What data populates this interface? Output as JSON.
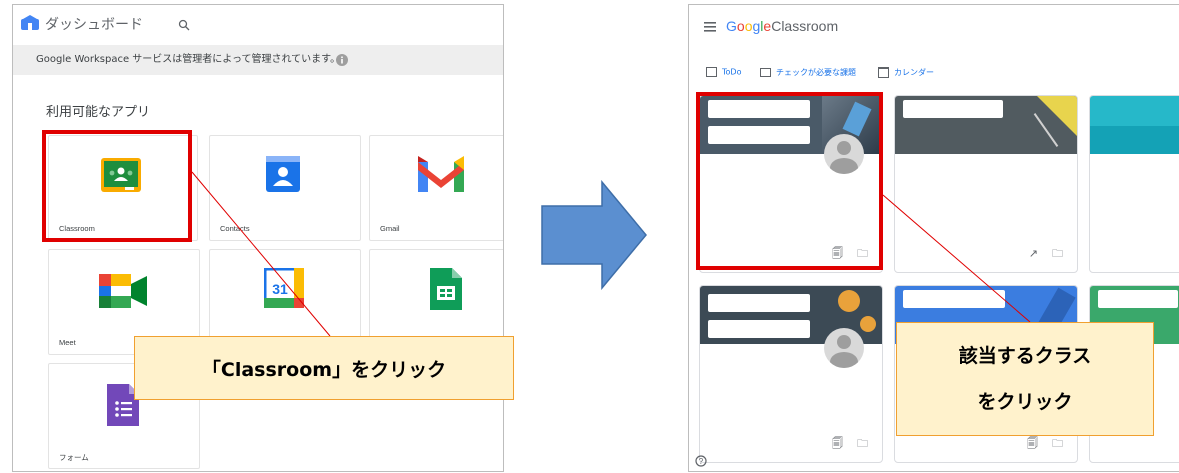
{
  "left": {
    "dashboard_title": "ダッシュボード",
    "admin_notice": "Google Workspace サービスは管理者によって管理されています。",
    "available_apps_label": "利用可能なアプリ",
    "apps": [
      {
        "label": "Classroom",
        "icon": "classroom-icon"
      },
      {
        "label": "Contacts",
        "icon": "contacts-icon"
      },
      {
        "label": "Gmail",
        "icon": "gmail-icon"
      },
      {
        "label": "Meet",
        "icon": "meet-icon"
      },
      {
        "label": "",
        "icon": "calendar-icon"
      },
      {
        "label": "",
        "icon": "sheets-icon"
      },
      {
        "label": "フォーム",
        "icon": "forms-icon"
      }
    ],
    "calendar_day": "31"
  },
  "right": {
    "logo_google": [
      "G",
      "o",
      "o",
      "g",
      "l",
      "e"
    ],
    "logo_product": "Classroom",
    "nav": {
      "todo": "ToDo",
      "review": "チェックが必要な課題",
      "calendar": "カレンダー"
    }
  },
  "callouts": {
    "left": "「Classroom」をクリック",
    "right_line1": "該当するクラス",
    "right_line2": "をクリック"
  },
  "colors": {
    "highlight": "#e00000",
    "callout_bg": "#fff2cc",
    "arrow": "#5b8fd0"
  }
}
